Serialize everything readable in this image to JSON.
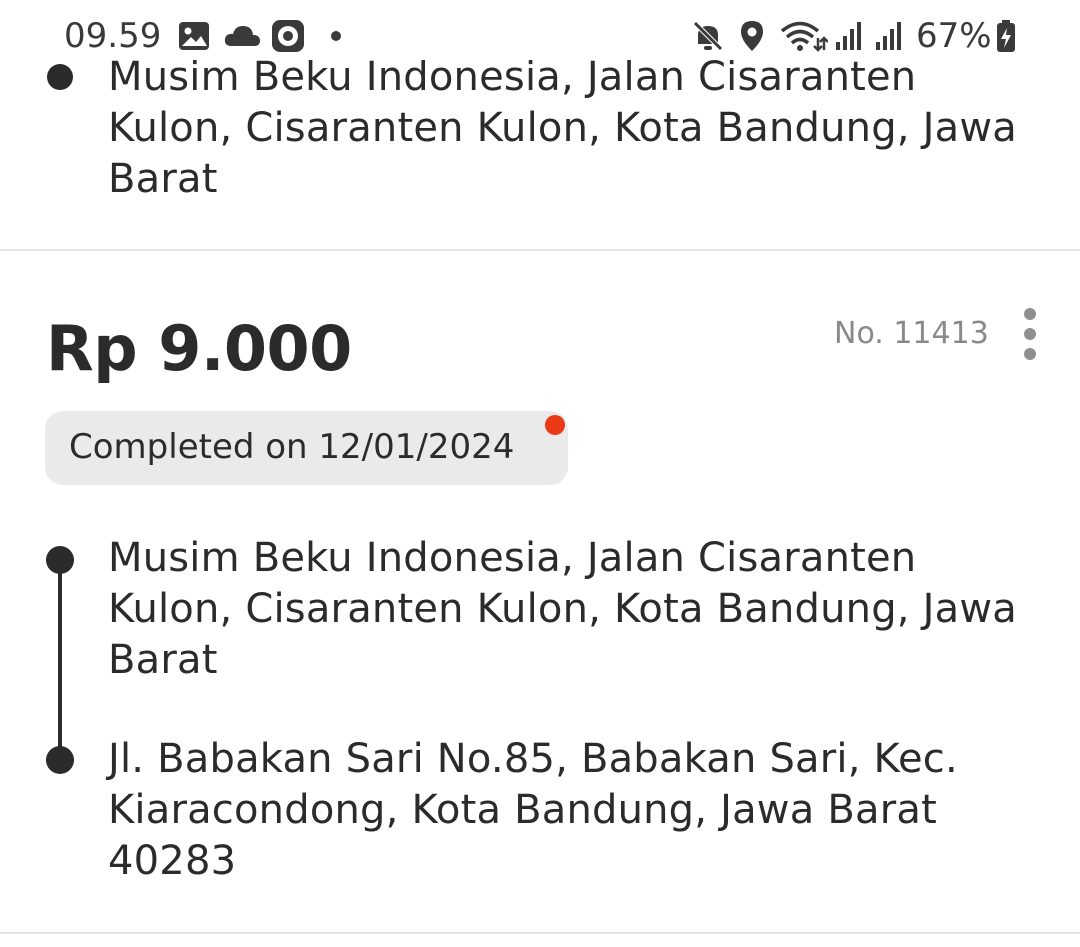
{
  "status_bar": {
    "time": "09.59",
    "battery": "67%",
    "icons": [
      "gallery-icon",
      "cloud-icon",
      "camera-ring-icon",
      "dot-icon",
      "mute-icon",
      "location-icon",
      "wifi-icon",
      "signal-icon",
      "signal-icon",
      "battery-charging-icon"
    ]
  },
  "previous_order": {
    "destination_address": "Musim Beku Indonesia, Jalan Cisaranten Kulon, Cisaranten Kulon, Kota Bandung, Jawa Barat"
  },
  "order": {
    "price": "Rp 9.000",
    "number": "No. 11413",
    "status": "Completed on 12/01/2024",
    "status_dot_color": "#ea3a16",
    "pickup_address": "Musim Beku Indonesia, Jalan Cisaranten Kulon, Cisaranten Kulon, Kota Bandung, Jawa Barat",
    "dropoff_address": "Jl. Babakan Sari No.85, Babakan Sari, Kec. Kiaracondong, Kota Bandung, Jawa Barat 40283"
  }
}
